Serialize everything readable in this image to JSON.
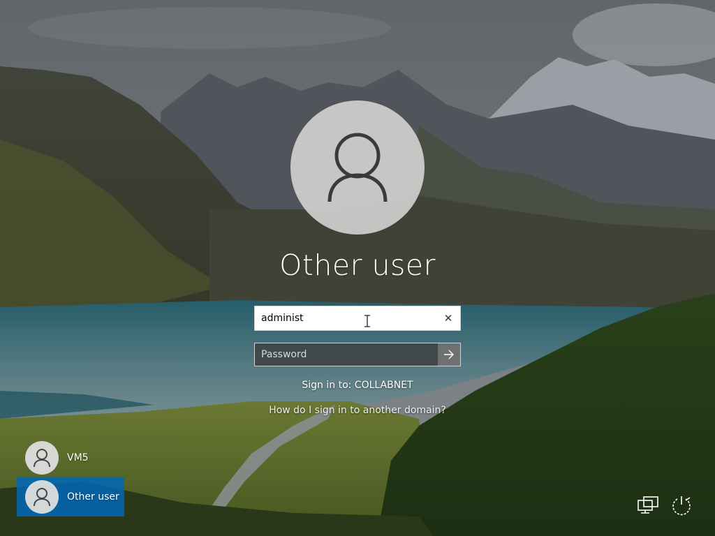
{
  "login": {
    "user_title": "Other user",
    "username_value": "administ",
    "password_placeholder": "Password",
    "sign_in_to": "Sign in to: COLLABNET",
    "domain_link": "How do I sign in to another domain?"
  },
  "users": [
    {
      "name": "VM5",
      "selected": false
    },
    {
      "name": "Other user",
      "selected": true
    }
  ],
  "icons": {
    "avatar": "person-icon",
    "clear": "close-icon",
    "submit": "arrow-right-icon",
    "network": "network-icon",
    "power": "power-icon"
  },
  "colors": {
    "selected_tile": "#0067B8"
  }
}
